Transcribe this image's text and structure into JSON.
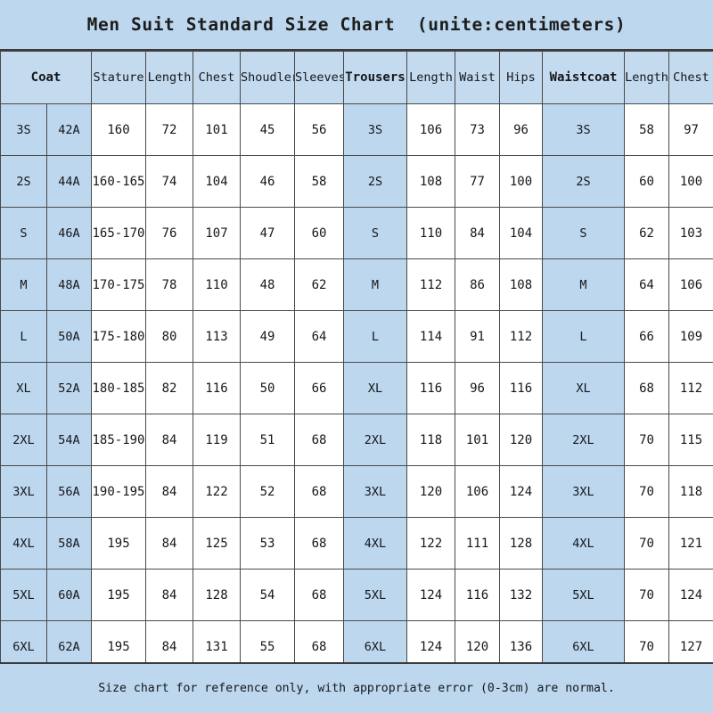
{
  "title": "Men Suit Standard Size Chart  (unite:centimeters)",
  "footer_note": "Size chart for reference only, with appropriate error (0-3cm) are normal.",
  "colors": {
    "band_background": "#bcd7ee",
    "size_cell_background": "#bdd7ef",
    "header_background": "#c3daef",
    "data_cell_background": "#ffffff",
    "border": "#4a4a4a",
    "text": "#15171a"
  },
  "headers": [
    {
      "label": "Coat",
      "bold": true
    },
    {
      "label": "",
      "bold": false
    },
    {
      "label": "Stature",
      "bold": false
    },
    {
      "label": "Length",
      "bold": false
    },
    {
      "label": "Chest",
      "bold": false
    },
    {
      "label": "Shoudler",
      "bold": false
    },
    {
      "label": "Sleeves",
      "bold": false
    },
    {
      "label": "Trousers",
      "bold": true
    },
    {
      "label": "Length",
      "bold": false
    },
    {
      "label": "Waist",
      "bold": false
    },
    {
      "label": "Hips",
      "bold": false
    },
    {
      "label": "Waistcoat",
      "bold": true
    },
    {
      "label": "Length",
      "bold": false
    },
    {
      "label": "Chest",
      "bold": false
    }
  ],
  "rows": [
    {
      "coat_size": "3S",
      "coat_num": "42A",
      "stature": "160",
      "coat_length": "72",
      "coat_chest": "101",
      "shoulder": "45",
      "sleeves": "56",
      "trousers_size": "3S",
      "trousers_length": "106",
      "waist": "73",
      "hips": "96",
      "waistcoat_size": "3S",
      "waistcoat_length": "58",
      "waistcoat_chest": "97"
    },
    {
      "coat_size": "2S",
      "coat_num": "44A",
      "stature": "160-165",
      "coat_length": "74",
      "coat_chest": "104",
      "shoulder": "46",
      "sleeves": "58",
      "trousers_size": "2S",
      "trousers_length": "108",
      "waist": "77",
      "hips": "100",
      "waistcoat_size": "2S",
      "waistcoat_length": "60",
      "waistcoat_chest": "100"
    },
    {
      "coat_size": "S",
      "coat_num": "46A",
      "stature": "165-170",
      "coat_length": "76",
      "coat_chest": "107",
      "shoulder": "47",
      "sleeves": "60",
      "trousers_size": "S",
      "trousers_length": "110",
      "waist": "84",
      "hips": "104",
      "waistcoat_size": "S",
      "waistcoat_length": "62",
      "waistcoat_chest": "103"
    },
    {
      "coat_size": "M",
      "coat_num": "48A",
      "stature": "170-175",
      "coat_length": "78",
      "coat_chest": "110",
      "shoulder": "48",
      "sleeves": "62",
      "trousers_size": "M",
      "trousers_length": "112",
      "waist": "86",
      "hips": "108",
      "waistcoat_size": "M",
      "waistcoat_length": "64",
      "waistcoat_chest": "106"
    },
    {
      "coat_size": "L",
      "coat_num": "50A",
      "stature": "175-180",
      "coat_length": "80",
      "coat_chest": "113",
      "shoulder": "49",
      "sleeves": "64",
      "trousers_size": "L",
      "trousers_length": "114",
      "waist": "91",
      "hips": "112",
      "waistcoat_size": "L",
      "waistcoat_length": "66",
      "waistcoat_chest": "109"
    },
    {
      "coat_size": "XL",
      "coat_num": "52A",
      "stature": "180-185",
      "coat_length": "82",
      "coat_chest": "116",
      "shoulder": "50",
      "sleeves": "66",
      "trousers_size": "XL",
      "trousers_length": "116",
      "waist": "96",
      "hips": "116",
      "waistcoat_size": "XL",
      "waistcoat_length": "68",
      "waistcoat_chest": "112"
    },
    {
      "coat_size": "2XL",
      "coat_num": "54A",
      "stature": "185-190",
      "coat_length": "84",
      "coat_chest": "119",
      "shoulder": "51",
      "sleeves": "68",
      "trousers_size": "2XL",
      "trousers_length": "118",
      "waist": "101",
      "hips": "120",
      "waistcoat_size": "2XL",
      "waistcoat_length": "70",
      "waistcoat_chest": "115"
    },
    {
      "coat_size": "3XL",
      "coat_num": "56A",
      "stature": "190-195",
      "coat_length": "84",
      "coat_chest": "122",
      "shoulder": "52",
      "sleeves": "68",
      "trousers_size": "3XL",
      "trousers_length": "120",
      "waist": "106",
      "hips": "124",
      "waistcoat_size": "3XL",
      "waistcoat_length": "70",
      "waistcoat_chest": "118"
    },
    {
      "coat_size": "4XL",
      "coat_num": "58A",
      "stature": "195",
      "coat_length": "84",
      "coat_chest": "125",
      "shoulder": "53",
      "sleeves": "68",
      "trousers_size": "4XL",
      "trousers_length": "122",
      "waist": "111",
      "hips": "128",
      "waistcoat_size": "4XL",
      "waistcoat_length": "70",
      "waistcoat_chest": "121"
    },
    {
      "coat_size": "5XL",
      "coat_num": "60A",
      "stature": "195",
      "coat_length": "84",
      "coat_chest": "128",
      "shoulder": "54",
      "sleeves": "68",
      "trousers_size": "5XL",
      "trousers_length": "124",
      "waist": "116",
      "hips": "132",
      "waistcoat_size": "5XL",
      "waistcoat_length": "70",
      "waistcoat_chest": "124"
    },
    {
      "coat_size": "6XL",
      "coat_num": "62A",
      "stature": "195",
      "coat_length": "84",
      "coat_chest": "131",
      "shoulder": "55",
      "sleeves": "68",
      "trousers_size": "6XL",
      "trousers_length": "124",
      "waist": "120",
      "hips": "136",
      "waistcoat_size": "6XL",
      "waistcoat_length": "70",
      "waistcoat_chest": "127"
    }
  ],
  "chart_data": {
    "type": "table",
    "title": "Men Suit Standard Size Chart  (unite:centimeters)",
    "units": "centimeters",
    "columns": [
      "Coat",
      "",
      "Stature",
      "Length",
      "Chest",
      "Shoudler",
      "Sleeves",
      "Trousers",
      "Length",
      "Waist",
      "Hips",
      "Waistcoat",
      "Length",
      "Chest"
    ],
    "values": [
      [
        "3S",
        "42A",
        "160",
        "72",
        "101",
        "45",
        "56",
        "3S",
        "106",
        "73",
        "96",
        "3S",
        "58",
        "97"
      ],
      [
        "2S",
        "44A",
        "160-165",
        "74",
        "104",
        "46",
        "58",
        "2S",
        "108",
        "77",
        "100",
        "2S",
        "60",
        "100"
      ],
      [
        "S",
        "46A",
        "165-170",
        "76",
        "107",
        "47",
        "60",
        "S",
        "110",
        "84",
        "104",
        "S",
        "62",
        "103"
      ],
      [
        "M",
        "48A",
        "170-175",
        "78",
        "110",
        "48",
        "62",
        "M",
        "112",
        "86",
        "108",
        "M",
        "64",
        "106"
      ],
      [
        "L",
        "50A",
        "175-180",
        "80",
        "113",
        "49",
        "64",
        "L",
        "114",
        "91",
        "112",
        "L",
        "66",
        "109"
      ],
      [
        "XL",
        "52A",
        "180-185",
        "82",
        "116",
        "50",
        "66",
        "XL",
        "116",
        "96",
        "116",
        "XL",
        "68",
        "112"
      ],
      [
        "2XL",
        "54A",
        "185-190",
        "84",
        "119",
        "51",
        "68",
        "2XL",
        "118",
        "101",
        "120",
        "2XL",
        "70",
        "115"
      ],
      [
        "3XL",
        "56A",
        "190-195",
        "84",
        "122",
        "52",
        "68",
        "3XL",
        "120",
        "106",
        "124",
        "3XL",
        "70",
        "118"
      ],
      [
        "4XL",
        "58A",
        "195",
        "84",
        "125",
        "53",
        "68",
        "4XL",
        "122",
        "111",
        "128",
        "4XL",
        "70",
        "121"
      ],
      [
        "5XL",
        "60A",
        "195",
        "84",
        "128",
        "54",
        "68",
        "5XL",
        "124",
        "116",
        "132",
        "5XL",
        "70",
        "124"
      ],
      [
        "6XL",
        "62A",
        "195",
        "84",
        "131",
        "55",
        "68",
        "6XL",
        "124",
        "120",
        "136",
        "6XL",
        "70",
        "127"
      ]
    ],
    "footnote": "Size chart for reference only, with appropriate error (0-3cm) are normal."
  }
}
